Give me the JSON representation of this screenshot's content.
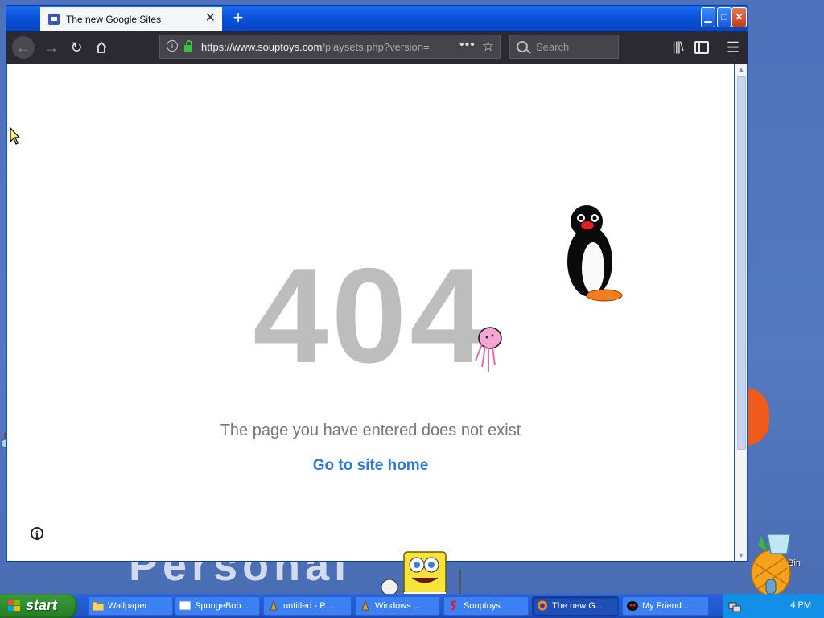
{
  "browser": {
    "tab_title": "The new Google Sites",
    "tab_close": "✕",
    "new_tab": "+",
    "url_host": "https://www.souptoys.com",
    "url_path": "/playsets.php?version=",
    "search_placeholder": "Search",
    "window_buttons": {
      "minimize": "▁",
      "maximize": "□",
      "close": "✕"
    }
  },
  "page": {
    "error_code": "404",
    "message": "The page you have entered does not exist",
    "home_link": "Go to site home"
  },
  "desktop": {
    "wallpaper_text": "Personal",
    "recycle_label": "cle Bin"
  },
  "taskbar": {
    "start_label": "start",
    "items": [
      {
        "label": "Wallpaper",
        "icon": "folder-icon"
      },
      {
        "label": "SpongeBob...",
        "icon": "window-icon"
      },
      {
        "label": "untitled - P...",
        "icon": "paint-icon"
      },
      {
        "label": "Windows ...",
        "icon": "media-icon"
      },
      {
        "label": "Souptoys",
        "icon": "souptoys-icon"
      },
      {
        "label": "The new G...",
        "icon": "firefox-icon"
      },
      {
        "label": "My Friend ...",
        "icon": "friend-icon"
      }
    ],
    "clock": "4 PM"
  },
  "colors": {
    "titlebar": "#0a4fd8",
    "toolbar": "#2b2a33",
    "link": "#2e7bd1",
    "error_code": "#bdbdbd",
    "start_green": "#2f8e2f"
  }
}
